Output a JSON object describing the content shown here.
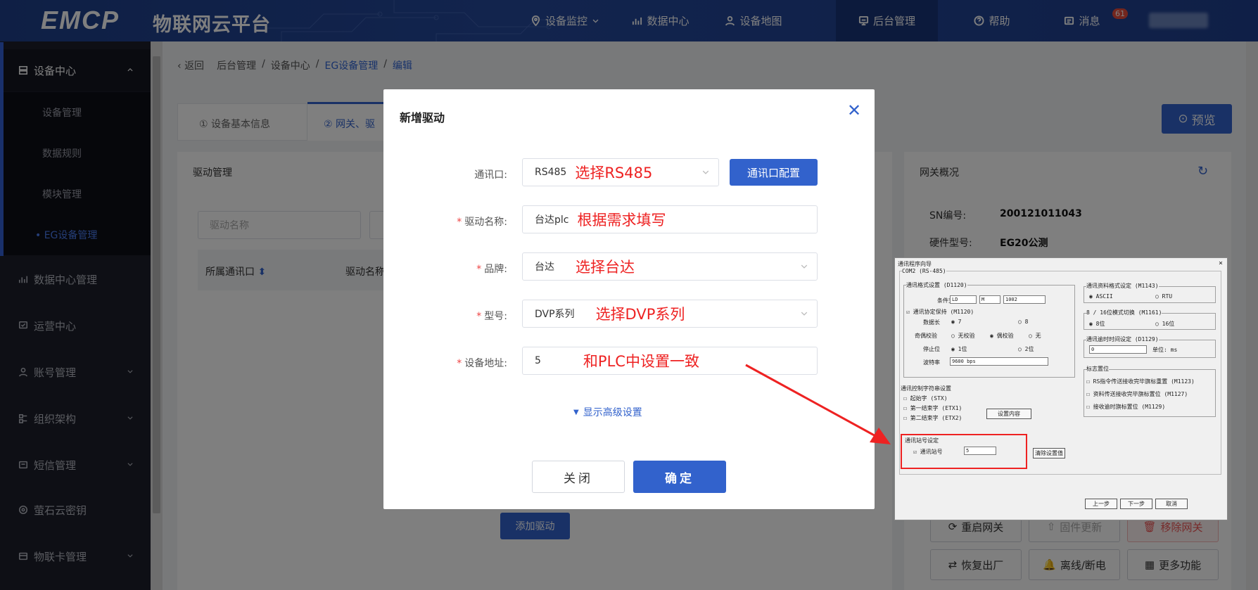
{
  "header": {
    "logo": "EMCP",
    "subtitle": "物联网云平台",
    "nav": [
      {
        "label": "设备监控",
        "icon": "location-pin-icon"
      },
      {
        "label": "数据中心",
        "icon": "chart-icon"
      },
      {
        "label": "设备地图",
        "icon": "person-pin-icon"
      },
      {
        "label": "后台管理",
        "icon": "monitor-icon"
      },
      {
        "label": "帮助",
        "icon": "question-circle-icon"
      },
      {
        "label": "消息",
        "icon": "message-icon",
        "badge": "61"
      }
    ]
  },
  "sidebar": {
    "head": "设备中心",
    "subitems": [
      "设备管理",
      "数据规则",
      "模块管理",
      "• EG设备管理"
    ],
    "items": [
      "数据中心管理",
      "运营中心",
      "账号管理",
      "组织架构",
      "短信管理",
      "萤石云密钥",
      "物联卡管理"
    ]
  },
  "breadcrumb": {
    "back": "返回",
    "path": [
      "后台管理",
      "/",
      "设备中心",
      "/",
      "EG设备管理",
      "/",
      "编辑"
    ]
  },
  "tabs": [
    "① 设备基本信息",
    "② 网关、驱"
  ],
  "preview_label": "预览",
  "driver_panel": {
    "title": "驱动管理",
    "search_placeholder": "驱动名称",
    "col_port": "所属通讯口",
    "col_name": "驱动名称",
    "add_button": "添加驱动"
  },
  "gateway_panel": {
    "title": "网关概况",
    "sn_label": "SN编号:",
    "sn_value": "200121011043",
    "hw_label": "硬件型号:",
    "hw_value": "EG20公测",
    "buttons_row1": [
      "重启网关",
      "固件更新",
      "移除网关"
    ],
    "buttons_row2": [
      "恢复出厂",
      "离线/断电",
      "更多功能"
    ]
  },
  "modal": {
    "title": "新增驱动",
    "fields": {
      "port": {
        "label": "通讯口:",
        "value": "RS485",
        "note": "选择RS485"
      },
      "name": {
        "label": "驱动名称:",
        "value": "台达plc",
        "note": "根据需求填写"
      },
      "brand": {
        "label": "品牌:",
        "value": "台达",
        "note": "选择台达"
      },
      "model": {
        "label": "型号:",
        "value": "DVP系列",
        "note": "选择DVP系列"
      },
      "address": {
        "label": "设备地址:",
        "value": "5",
        "note": "和PLC中设置一致"
      }
    },
    "port_config_button": "通讯口配置",
    "advanced": "显示高级设置",
    "close": "关闭",
    "confirm": "确定"
  },
  "inset": {
    "title": "通讯程序向导",
    "port": "COM2 (RS-485)",
    "g1": "通讯格式设置 (D1120)",
    "g1_rows": [
      "条件式",
      "数据长",
      "奇偶校验",
      "停止位",
      "波特率"
    ],
    "g1_cond": "LD",
    "g1_m": "M",
    "g1_num": "1002",
    "g1_protect": "通讯协定保持 (M1120)",
    "g1_r_data": [
      "7",
      "8"
    ],
    "g1_r_parity": [
      "无校验",
      "偶校验",
      "无"
    ],
    "g1_r_stop": [
      "1位",
      "2位"
    ],
    "baud": "9600 bps",
    "g2": "通讯控制字符串设置",
    "g2_items": [
      "起始字 (STX)",
      "第一结束字 (ETX1)",
      "第二结束字 (ETX2)"
    ],
    "g2_btn": "设置内容",
    "g3": "通讯资料格式设定 (M1143)",
    "g3_opts": [
      "ASCII",
      "RTU"
    ],
    "g4": "8 / 16位模式切换 (M1161)",
    "g4_opts": [
      "8位",
      "16位"
    ],
    "g5": "通讯逾时时间设定 (D1129)",
    "g5_val": "0",
    "g5_unit": "单位: ms",
    "g6": "标志置位",
    "g6_items": [
      "RS指令传送接收完毕旗标重置 (M1123)",
      "资料传送接收完毕旗标置位 (M1127)",
      "接收逾时旗标置位 (M1129)"
    ],
    "g7": "通讯站号设定",
    "g7_label": "通讯站号",
    "g7_val": "5",
    "clear_btn": "清除设置值",
    "nav_btns": [
      "上一步",
      "下一步",
      "取消"
    ]
  },
  "colors": {
    "primary": "#3262cc",
    "annotation": "#ee2222",
    "sidebar": "#1c1f2b"
  }
}
